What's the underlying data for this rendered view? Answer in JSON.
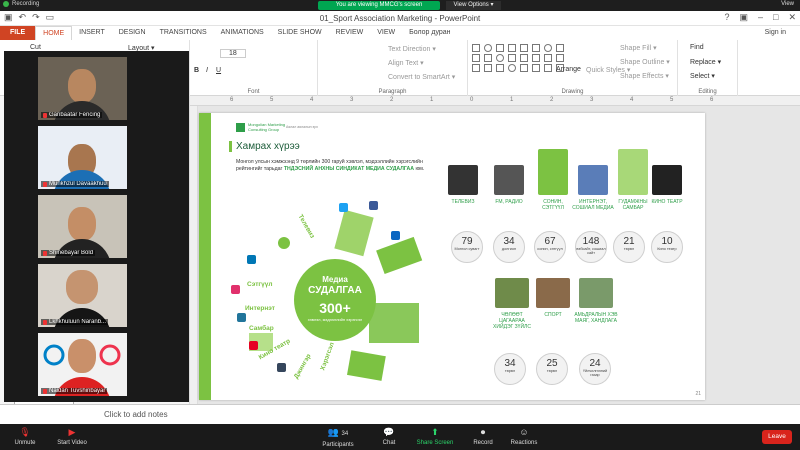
{
  "zoom": {
    "recording": "Recording",
    "viewing_banner": "You are viewing MMCG's screen",
    "view_options": "View Options ▾",
    "view": "View",
    "participants_count": "34",
    "toolbar": [
      {
        "label": "Unmute",
        "icon": "mic-muted-icon"
      },
      {
        "label": "Start Video",
        "icon": "camera-off-icon"
      },
      {
        "label": "Participants",
        "icon": "participants-icon"
      },
      {
        "label": "Chat",
        "icon": "chat-icon"
      },
      {
        "label": "Share Screen",
        "icon": "share-screen-icon"
      },
      {
        "label": "Record",
        "icon": "record-icon"
      },
      {
        "label": "Reactions",
        "icon": "reactions-icon"
      }
    ],
    "leave": "Leave",
    "participants": [
      {
        "name": "Ganbaatar Fencing"
      },
      {
        "name": "Munkhzul Davaakhuu"
      },
      {
        "name": "Shinebayar Bold"
      },
      {
        "name": "Lkhkhuluun Naranb..."
      },
      {
        "name": "Naidan Tuvshinbayar"
      }
    ]
  },
  "ppt": {
    "title": "01_Sport Association Marketing - PowerPoint",
    "file_tab": "FILE",
    "tabs": [
      "HOME",
      "INSERT",
      "DESIGN",
      "TRANSITIONS",
      "ANIMATIONS",
      "SLIDE SHOW",
      "REVIEW",
      "VIEW",
      "Болор дуран"
    ],
    "active_tab": "HOME",
    "sign_in": "Sign in",
    "ribbon": {
      "cut": "Cut",
      "layout": "Layout ▾",
      "font_size": "18",
      "font_group": "Font",
      "paragraph_group": "Paragraph",
      "text_direction": "Text Direction ▾",
      "align_text": "Align Text ▾",
      "smartart": "Convert to SmartArt ▾",
      "drawing_group": "Drawing",
      "arrange": "Arrange",
      "quick_styles": "Quick Styles ▾",
      "shape_fill": "Shape Fill ▾",
      "shape_outline": "Shape Outline ▾",
      "shape_effects": "Shape Effects ▾",
      "find": "Find",
      "replace": "Replace ▾",
      "select": "Select ▾",
      "editing_group": "Editing"
    },
    "ruler_ticks": [
      "6",
      "5",
      "4",
      "3",
      "2",
      "1",
      "0",
      "1",
      "2",
      "3",
      "4",
      "5",
      "6"
    ],
    "notes_placeholder": "Click to add notes"
  },
  "slide": {
    "logo_title": "Mongolian Marketing Consulting Group",
    "logo_sub": "Аялал аялалын эрх",
    "title": "Хамрах хүрээ",
    "para_plain": "Монгол улсын хэмжээнд 9 төрлийн 300 гаруй хэвлэл, мэдээллийн хэрэгслийн рейтингийг тарьдаг",
    "para_highlight1": "ТНДЭСНИЙ АНХНЫ СИНДИКАТ МЕДИА СУДАЛГАА",
    "para_end": "юм.",
    "badge": {
      "line1": "Медиа",
      "line2": "СУДАЛГАА",
      "line3": "300+",
      "line4": "хэвлэл, мэдээллийн хэрэгсэл"
    },
    "collage_words": [
      "Телевиз",
      "Сэтгүүл",
      "Интернэт",
      "Самбар",
      "Кино театр",
      "Джингэр",
      "Хэрэгсэл",
      "Рекламт"
    ],
    "media_top": [
      {
        "label": "ТЕЛЕВИЗ",
        "value": "79",
        "sub": "Монгол сувагт",
        "color": "#333333"
      },
      {
        "label": "FM, РАДИО",
        "value": "34",
        "sub": "долгион",
        "color": "#444444"
      },
      {
        "label": "СОНИН, СЭТГҮҮЛ",
        "value": "67",
        "sub": "сонин, сэтгүүл",
        "color": "#7cc242"
      },
      {
        "label": "ИНТЕРНЭТ, СОШИАЛ МЕДИА",
        "value": "148",
        "sub": "вэбсайт, сошиал сайт",
        "color": "#5a7db8"
      },
      {
        "label": "ГУДАМЖНЫ САМБАР",
        "value": "21",
        "sub": "төрөл",
        "color": "#a8d878"
      },
      {
        "label": "КИНО ТЕАТР",
        "value": "10",
        "sub": "Кино театр",
        "color": "#222222"
      }
    ],
    "media_bottom": [
      {
        "label": "ЧӨЛӨӨТ ЦАГААРАА ХИЙДЭГ ЗҮЙЛС",
        "value": "34",
        "sub": "төрөл",
        "color": "#6f8b4a"
      },
      {
        "label": "СПОРТ",
        "value": "25",
        "sub": "төрөл",
        "color": "#8a6a4a"
      },
      {
        "label": "АМЬДРАЛЫН ХЭВ МАЯГ, ХАНДЛАГА",
        "value": "24",
        "sub": "Үйлчилгээний газар",
        "color": "#7a9a6a"
      }
    ],
    "page_number": "21"
  }
}
